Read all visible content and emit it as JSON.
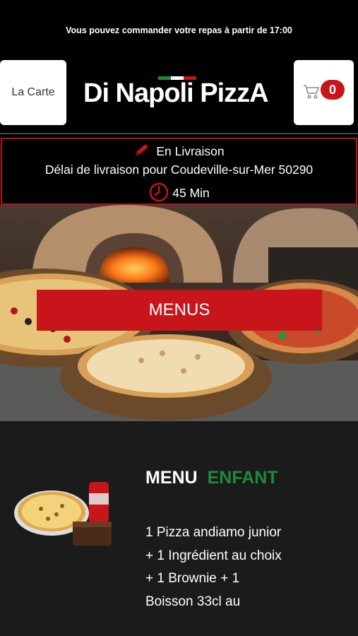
{
  "notice": "Vous pouvez commander votre repas à partir de 17:00",
  "header": {
    "carte_label": "La Carte",
    "logo_text": "Di Napoli PizzA",
    "cart_count": "0"
  },
  "delivery": {
    "mode": "En Livraison",
    "location": "Délai de livraison pour Coudeville-sur-Mer 50290",
    "time": "45 Min"
  },
  "hero": {
    "menus_label": "MENUS"
  },
  "product": {
    "title_word1": "MENU",
    "title_word2": "ENFANT",
    "description": "1 Pizza andiamo junior   + 1 Ingrédient au choix   + 1 Brownie   + 1 Boisson 33cl au"
  },
  "colors": {
    "accent_red": "#c8141b",
    "accent_green": "#1f8a3a",
    "background": "#000000",
    "product_bg": "#1b1b1b"
  },
  "icons": [
    "pencil-icon",
    "clock-icon",
    "cart-icon"
  ]
}
